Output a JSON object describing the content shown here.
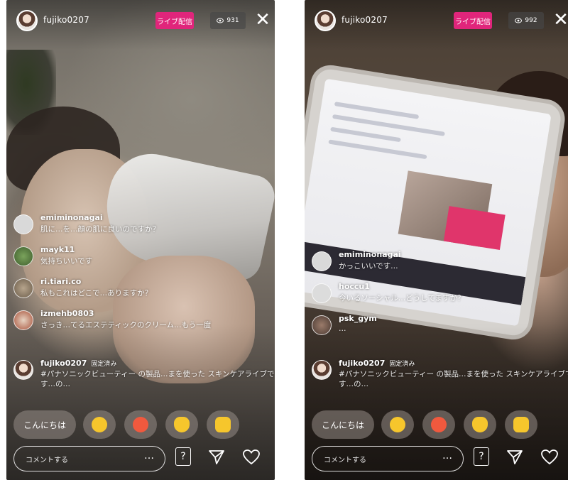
{
  "screens": [
    {
      "host": "fujiko0207",
      "live_label": "ライブ配信",
      "viewer_count": "931",
      "viewer_icon": "eye-icon",
      "comments": [
        {
          "user": "emiminonagai",
          "text": "肌に…を…顔の肌に良いのですか？"
        },
        {
          "user": "mayk11",
          "text": "気持ちいいです"
        },
        {
          "user": "ri.tiari.co",
          "text": "私もこれはどこで…ありますか？"
        },
        {
          "user": "izmehb0803",
          "text": "さっき…てるエステティックのクリーム…もう一度"
        }
      ],
      "host_comment": {
        "user": "fujiko0207",
        "pin_label": "固定済み",
        "text": "#パナソニックビューティー の製品…まを使った スキンケアライブです…の…"
      },
      "quick_reply": "こんにちは",
      "comment_placeholder": "コメントする",
      "more_label": "…",
      "qa_label": "?"
    },
    {
      "host": "fujiko0207",
      "live_label": "ライブ配信",
      "viewer_count": "992",
      "viewer_icon": "eye-icon",
      "comments": [
        {
          "user": "emiminonagai",
          "text": "かっこいいです…"
        },
        {
          "user": "hoccu1",
          "text": "今いるソーシャル…どうしてますか？"
        },
        {
          "user": "psk_gym",
          "text": "…"
        }
      ],
      "host_comment": {
        "user": "fujiko0207",
        "pin_label": "固定済み",
        "text": "#パナソニックビューティー の製品…まを使った スキンケアライブです…の…"
      },
      "quick_reply": "こんにちは",
      "comment_placeholder": "コメントする",
      "more_label": "…",
      "qa_label": "?"
    }
  ],
  "colors": {
    "live_pink": "#e0257b",
    "emoji_yellow": "#f6c62c",
    "emoji_red": "#f0593e"
  },
  "icons": [
    "close-icon",
    "question-box-icon",
    "send-icon",
    "heart-icon",
    "smile-emoji-icon",
    "heart-eyes-emoji-icon",
    "clap-emoji-icon",
    "thumbs-up-emoji-icon"
  ]
}
